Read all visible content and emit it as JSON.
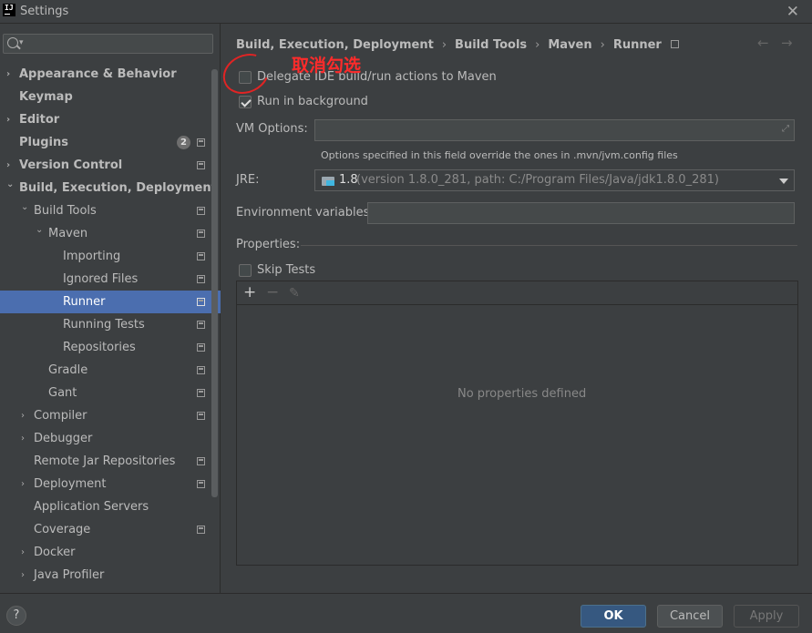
{
  "window": {
    "title": "Settings"
  },
  "sidebar": {
    "items": [
      {
        "label": "Appearance & Behavior",
        "arrow": "›"
      },
      {
        "label": "Keymap",
        "arrow": ""
      },
      {
        "label": "Editor",
        "arrow": "›"
      },
      {
        "label": "Plugins",
        "arrow": "",
        "badge": "2"
      },
      {
        "label": "Version Control",
        "arrow": "›"
      },
      {
        "label": "Build, Execution, Deployment",
        "arrow": "⌄"
      },
      {
        "label": "Build Tools",
        "arrow": "⌄"
      },
      {
        "label": "Maven",
        "arrow": "⌄"
      },
      {
        "label": "Importing",
        "arrow": ""
      },
      {
        "label": "Ignored Files",
        "arrow": ""
      },
      {
        "label": "Runner",
        "arrow": ""
      },
      {
        "label": "Running Tests",
        "arrow": ""
      },
      {
        "label": "Repositories",
        "arrow": ""
      },
      {
        "label": "Gradle",
        "arrow": ""
      },
      {
        "label": "Gant",
        "arrow": ""
      },
      {
        "label": "Compiler",
        "arrow": "›"
      },
      {
        "label": "Debugger",
        "arrow": "›"
      },
      {
        "label": "Remote Jar Repositories",
        "arrow": ""
      },
      {
        "label": "Deployment",
        "arrow": "›"
      },
      {
        "label": "Application Servers",
        "arrow": ""
      },
      {
        "label": "Coverage",
        "arrow": ""
      },
      {
        "label": "Docker",
        "arrow": "›"
      },
      {
        "label": "Java Profiler",
        "arrow": "›"
      }
    ]
  },
  "breadcrumb": {
    "items": [
      "Build, Execution, Deployment",
      "Build Tools",
      "Maven",
      "Runner"
    ],
    "separator": "›"
  },
  "nav": {
    "back": "←",
    "forward": "→"
  },
  "runner": {
    "delegate_label": "Delegate IDE build/run actions to Maven",
    "delegate_checked": false,
    "background_label": "Run in background",
    "background_checked": true,
    "vm_label": "VM Options:",
    "vm_value": "",
    "vm_hint": "Options specified in this field override the ones in .mvn/jvm.config files",
    "jre_label": "JRE:",
    "jre_version": "1.8",
    "jre_detail": "(version 1.8.0_281, path: C:/Program Files/Java/jdk1.8.0_281)",
    "env_label": "Environment variables:",
    "env_value": "",
    "properties_label": "Properties:",
    "skip_tests_label": "Skip Tests",
    "skip_tests_checked": false,
    "empty_text": "No properties defined"
  },
  "annotation": {
    "text": "取消勾选",
    "color": "#ff2b2b"
  },
  "footer": {
    "ok": "OK",
    "cancel": "Cancel",
    "apply": "Apply",
    "help": "?"
  },
  "colors": {
    "selection": "#4b6eaf",
    "background": "#3c3f41",
    "primary_button": "#365880"
  }
}
